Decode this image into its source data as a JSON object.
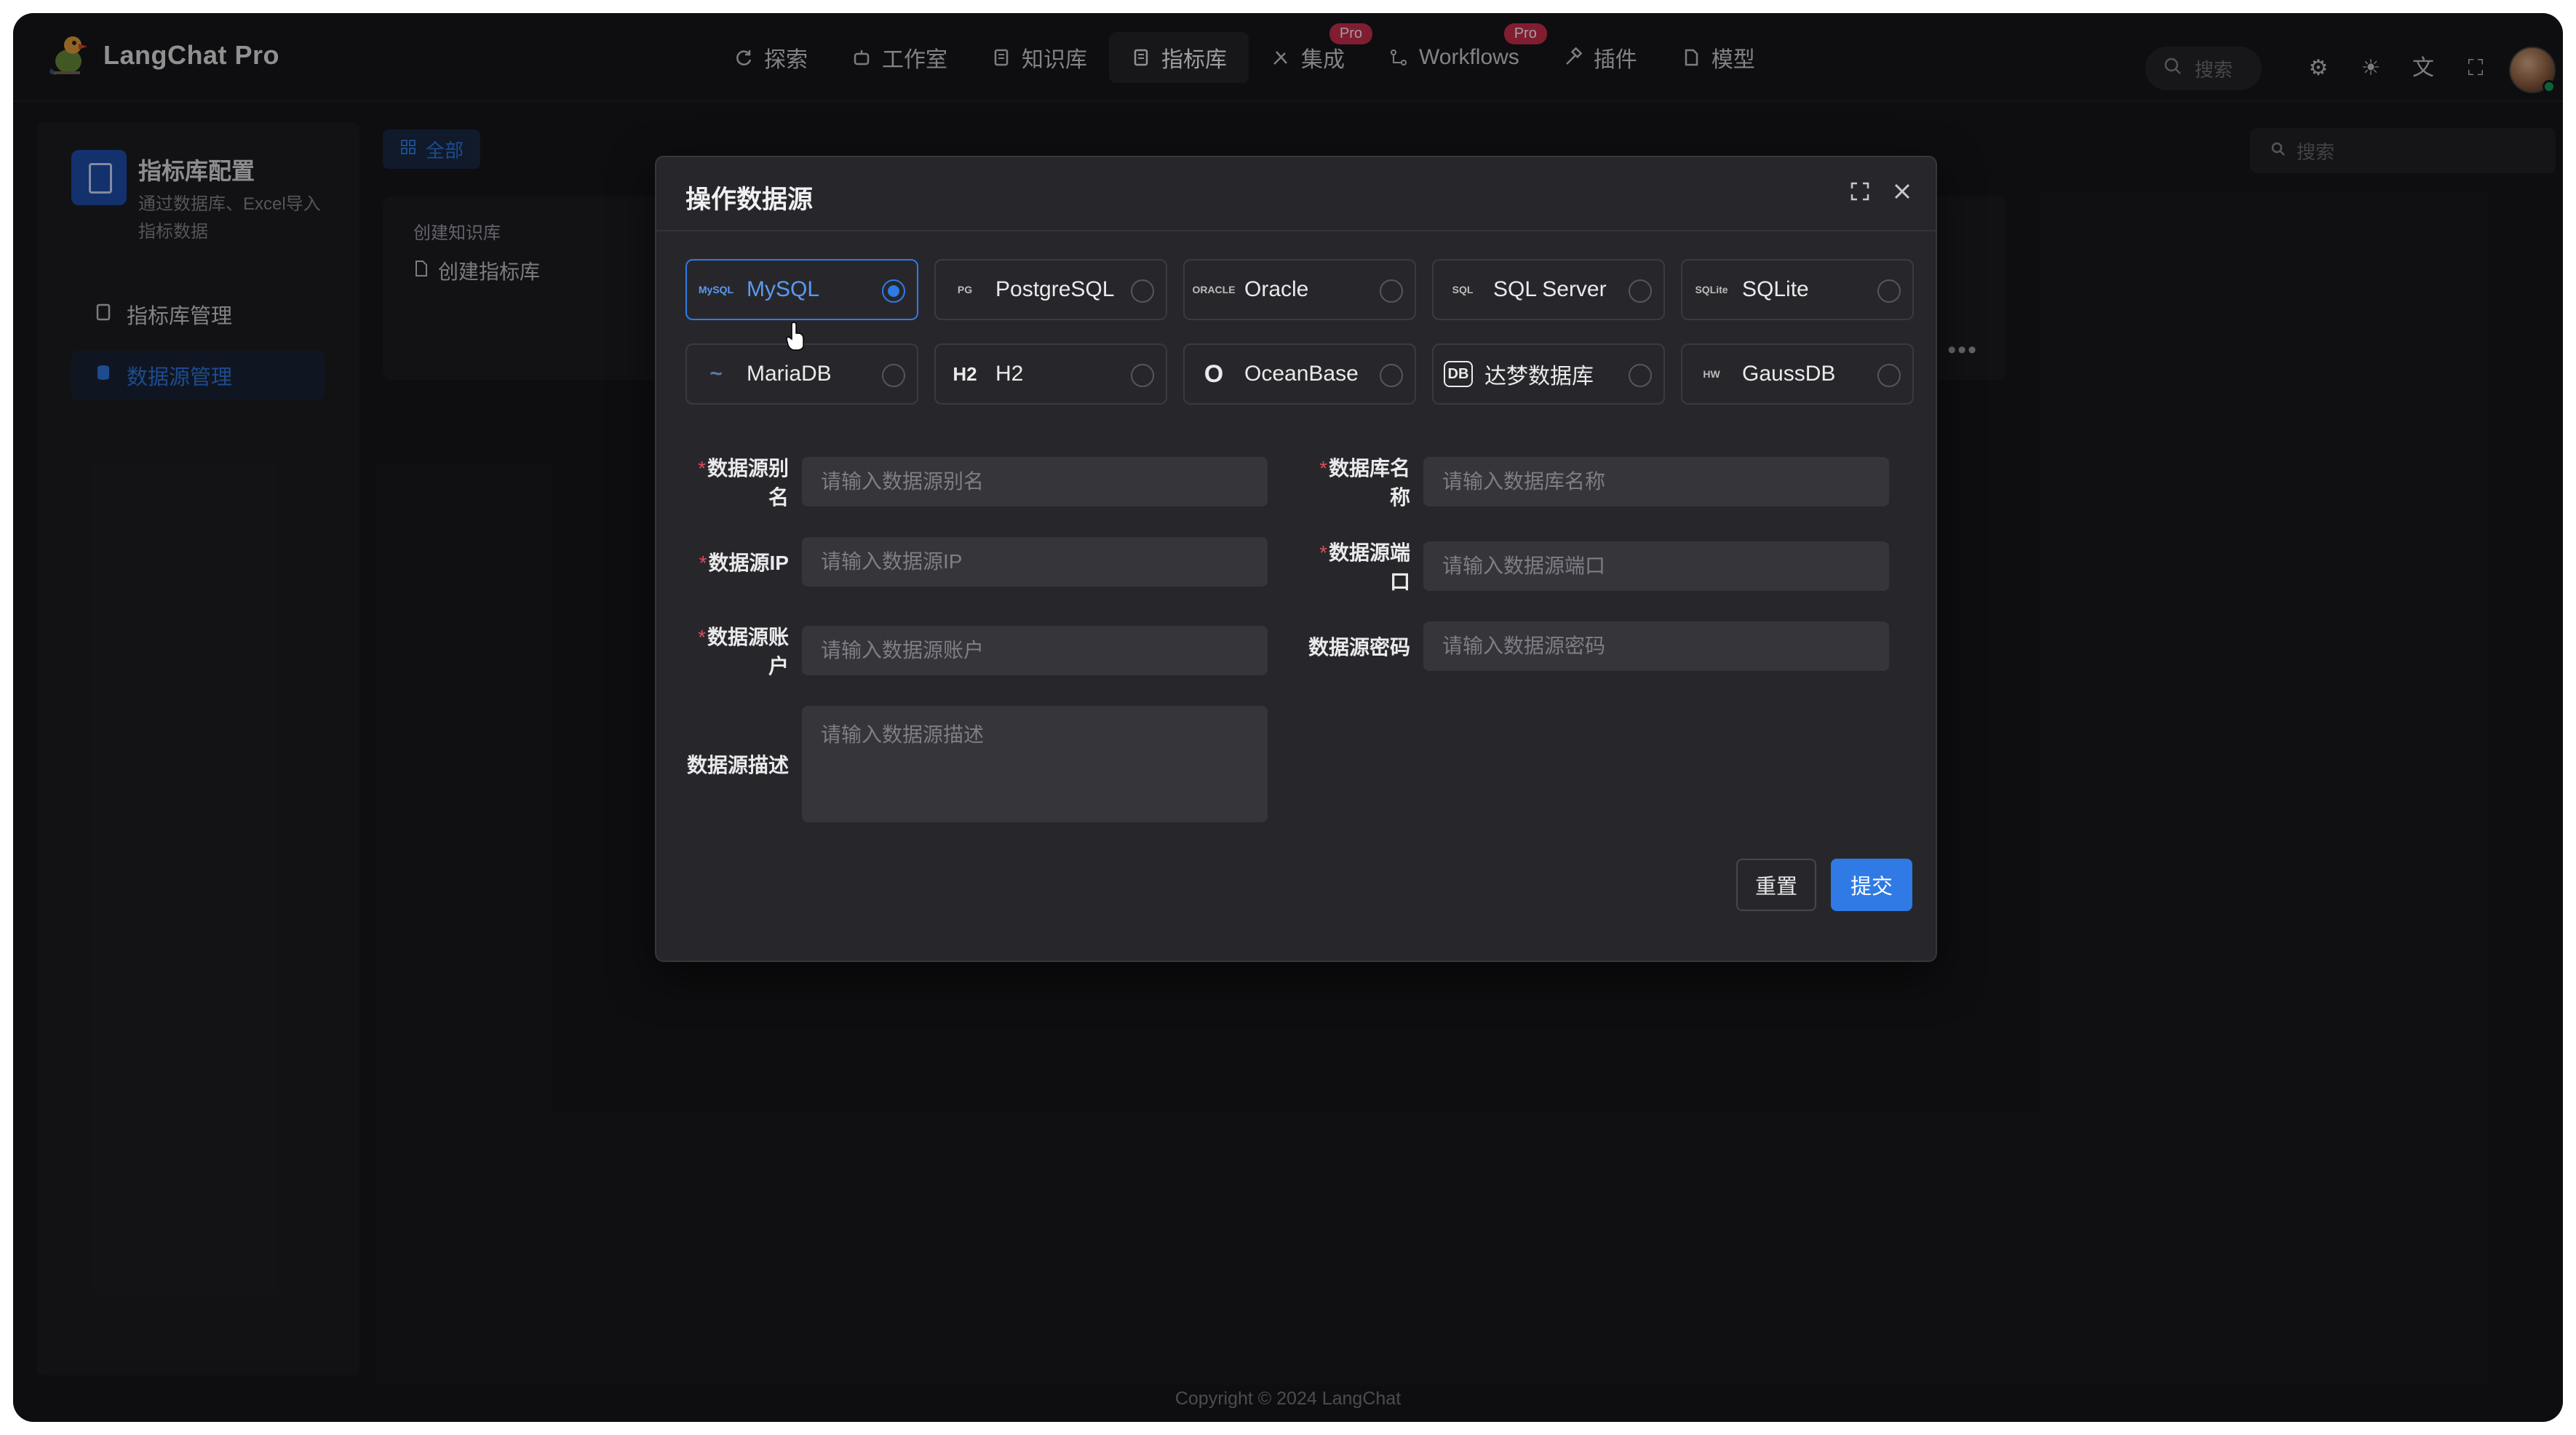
{
  "app": {
    "title": "LangChat Pro"
  },
  "nav": [
    {
      "label": "探索",
      "icon": "refresh-icon",
      "badge": ""
    },
    {
      "label": "工作室",
      "icon": "robot-icon",
      "badge": ""
    },
    {
      "label": "知识库",
      "icon": "book-icon",
      "badge": ""
    },
    {
      "label": "指标库",
      "icon": "document-icon",
      "badge": ""
    },
    {
      "label": "集成",
      "icon": "tools-icon",
      "badge": "Pro"
    },
    {
      "label": "Workflows",
      "icon": "workflow-icon",
      "badge": "Pro"
    },
    {
      "label": "插件",
      "icon": "hammer-icon",
      "badge": ""
    },
    {
      "label": "模型",
      "icon": "file-icon",
      "badge": ""
    }
  ],
  "header": {
    "search_placeholder": "搜索"
  },
  "sidebar": {
    "title": "指标库配置",
    "subtitle": "通过数据库、Excel导入指标数据",
    "items": [
      {
        "label": "指标库管理"
      },
      {
        "label": "数据源管理"
      }
    ]
  },
  "content": {
    "filter_all": "全部",
    "card_label": "创建知识库",
    "card_item": "创建指标库",
    "right_search_placeholder": "搜索"
  },
  "modal": {
    "title": "操作数据源",
    "databases": [
      {
        "name": "MySQL",
        "logo": "MySQL",
        "selected": true
      },
      {
        "name": "PostgreSQL",
        "logo": "PG",
        "selected": false
      },
      {
        "name": "Oracle",
        "logo": "ORACLE",
        "selected": false
      },
      {
        "name": "SQL Server",
        "logo": "SQL",
        "selected": false
      },
      {
        "name": "SQLite",
        "logo": "SQLite",
        "selected": false
      },
      {
        "name": "MariaDB",
        "logo": "~",
        "selected": false
      },
      {
        "name": "H2",
        "logo": "H2",
        "selected": false
      },
      {
        "name": "OceanBase",
        "logo": "O",
        "selected": false
      },
      {
        "name": "达梦数据库",
        "logo": "DB",
        "selected": false
      },
      {
        "name": "GaussDB",
        "logo": "HW",
        "selected": false
      }
    ],
    "fields": {
      "alias": {
        "label": "数据源别名",
        "placeholder": "请输入数据源别名",
        "required": true
      },
      "dbname": {
        "label": "数据库名称",
        "placeholder": "请输入数据库名称",
        "required": true
      },
      "ip": {
        "label": "数据源IP",
        "placeholder": "请输入数据源IP",
        "required": true
      },
      "port": {
        "label": "数据源端口",
        "placeholder": "请输入数据源端口",
        "required": true
      },
      "account": {
        "label": "数据源账户",
        "placeholder": "请输入数据源账户",
        "required": true
      },
      "password": {
        "label": "数据源密码",
        "placeholder": "请输入数据源密码",
        "required": false
      },
      "desc": {
        "label": "数据源描述",
        "placeholder": "请输入数据源描述",
        "required": false
      }
    },
    "reset_label": "重置",
    "submit_label": "提交"
  },
  "footer": {
    "copyright": "Copyright © 2024 LangChat"
  },
  "colors": {
    "accent": "#2f7ae5",
    "background": "#18181b",
    "badge": "#d03050"
  }
}
